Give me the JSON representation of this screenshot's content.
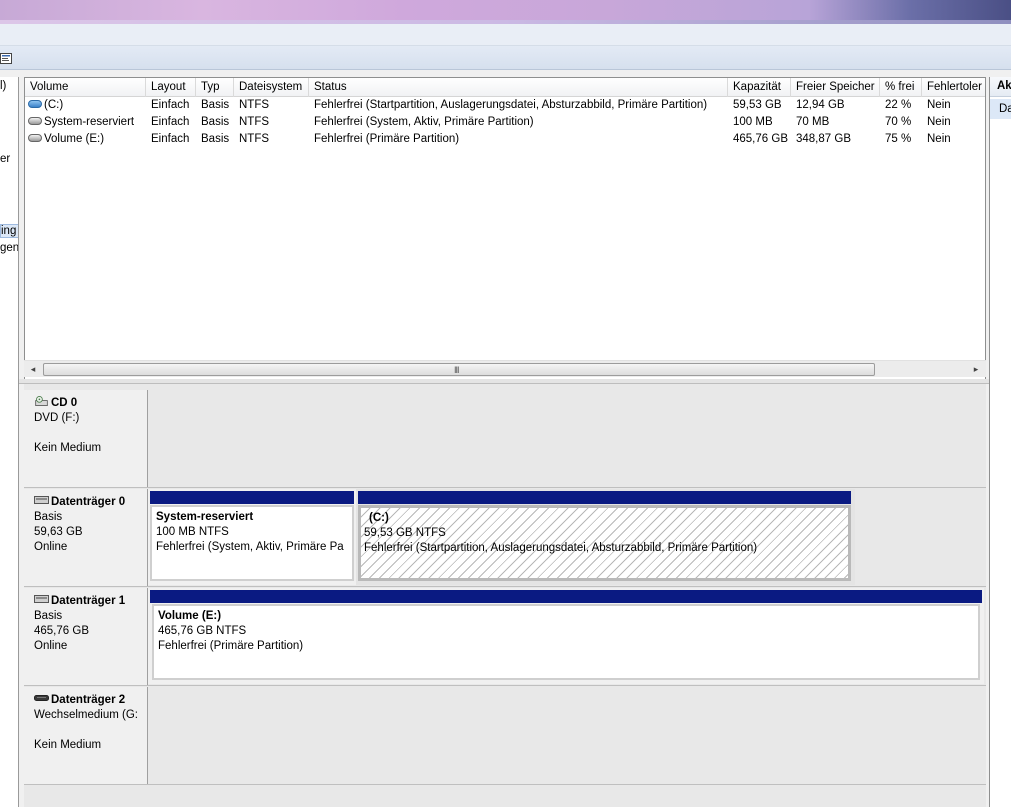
{
  "left_pane": {
    "items": [
      "l)",
      "er",
      "ing",
      "gen"
    ]
  },
  "list": {
    "columns": [
      "Volume",
      "Layout",
      "Typ",
      "Dateisystem",
      "Status",
      "Kapazität",
      "Freier Speicher",
      "% frei",
      "Fehlertoler"
    ],
    "rows": [
      {
        "volume": "(C:)",
        "layout": "Einfach",
        "typ": "Basis",
        "fs": "NTFS",
        "status": "Fehlerfrei (Startpartition, Auslagerungsdatei, Absturzabbild, Primäre Partition)",
        "kap": "59,53 GB",
        "frei": "12,94 GB",
        "pct": "22 %",
        "fehler": "Nein"
      },
      {
        "volume": "System-reserviert",
        "layout": "Einfach",
        "typ": "Basis",
        "fs": "NTFS",
        "status": "Fehlerfrei (System, Aktiv, Primäre Partition)",
        "kap": "100 MB",
        "frei": "70 MB",
        "pct": "70 %",
        "fehler": "Nein"
      },
      {
        "volume": "Volume (E:)",
        "layout": "Einfach",
        "typ": "Basis",
        "fs": "NTFS",
        "status": "Fehlerfrei (Primäre Partition)",
        "kap": "465,76 GB",
        "frei": "348,87 GB",
        "pct": "75 %",
        "fehler": "Nein"
      }
    ],
    "scroll_grip": "III"
  },
  "disks": {
    "cd0": {
      "name": "CD 0",
      "line1": "DVD (F:)",
      "line3": "Kein Medium"
    },
    "disk0": {
      "name": "Datenträger 0",
      "type": "Basis",
      "size": "59,63 GB",
      "state": "Online",
      "p1": {
        "name": "System-reserviert",
        "size": "100 MB NTFS",
        "status": "Fehlerfrei (System, Aktiv, Primäre Pa"
      },
      "p2": {
        "name": "(C:)",
        "size": "59,53 GB NTFS",
        "status": "Fehlerfrei (Startpartition, Auslagerungsdatei, Absturzabbild, Primäre Partition)"
      }
    },
    "disk1": {
      "name": "Datenträger 1",
      "type": "Basis",
      "size": "465,76 GB",
      "state": "Online",
      "p1": {
        "name": "Volume  (E:)",
        "size": "465,76 GB NTFS",
        "status": "Fehlerfrei (Primäre Partition)"
      }
    },
    "disk2": {
      "name": "Datenträger 2",
      "line1": "Wechselmedium (G:",
      "line3": "Kein Medium"
    }
  },
  "right_pane": {
    "header": "Ak",
    "item": "Da"
  },
  "colors": {
    "partition_header": "#0a1a82",
    "selection": "#dce8f7"
  }
}
